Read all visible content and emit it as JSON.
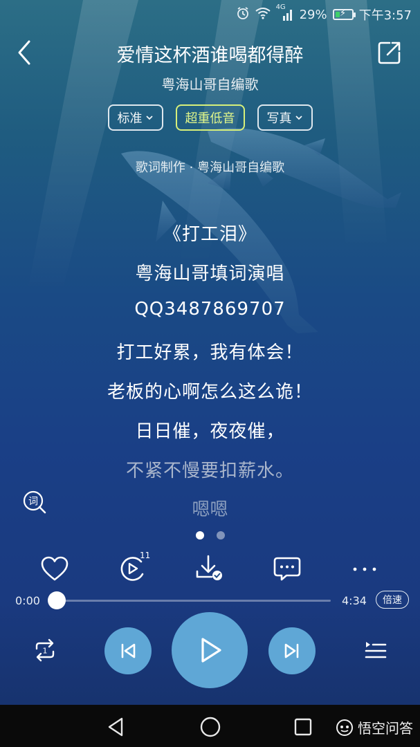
{
  "status_bar": {
    "network": "4G",
    "battery_percent": "29%",
    "battery_level": 0.29,
    "time": "下午3:57"
  },
  "header": {
    "title": "爱情这杯酒谁喝都得醉",
    "artist": "粤海山哥自编歌"
  },
  "chips": [
    {
      "label": "标准",
      "active": false,
      "has_dropdown": true
    },
    {
      "label": "超重低音",
      "active": true,
      "has_dropdown": false
    },
    {
      "label": "写真",
      "active": false,
      "has_dropdown": true
    }
  ],
  "lyrics_credit": "歌词制作 · 粤海山哥自编歌",
  "lyrics": [
    {
      "text": "《打工泪》",
      "dim": false
    },
    {
      "text": "粤海山哥填词演唱",
      "dim": false
    },
    {
      "text": "QQ3487869707",
      "dim": false
    },
    {
      "text": "打工好累，我有体会！",
      "dim": false
    },
    {
      "text": "老板的心啊怎么这么诡！",
      "dim": false
    },
    {
      "text": "日日催，夜夜催，",
      "dim": false
    },
    {
      "text": "不紧不慢要扣薪水。",
      "dim": true
    }
  ],
  "lyrics_last": "嗯嗯",
  "lyrics_icon": {
    "name": "lyrics-search-icon",
    "glyph": "词"
  },
  "pager": {
    "count": 2,
    "active_index": 0
  },
  "actions": {
    "like": "heart-icon",
    "video": "video-icon",
    "video_count": "11",
    "download": "download-icon",
    "comment": "comment-icon",
    "more": "more-icon"
  },
  "progress": {
    "current": "0:00",
    "total": "4:34",
    "fraction": 0.0,
    "speed_label": "倍速"
  },
  "controls": {
    "repeat": "repeat-one-icon",
    "prev": "skip-previous-icon",
    "play": "play-icon",
    "next": "skip-next-icon",
    "playlist": "playlist-icon"
  },
  "navbar": {
    "back": "nav-back-icon",
    "home": "nav-home-icon",
    "recents": "nav-recents-icon"
  },
  "watermark": "悟空问答",
  "colors": {
    "accent_chip": "#d8f07a",
    "control_blue": "#5fa7d6",
    "progress_fill": "#ffffff"
  }
}
